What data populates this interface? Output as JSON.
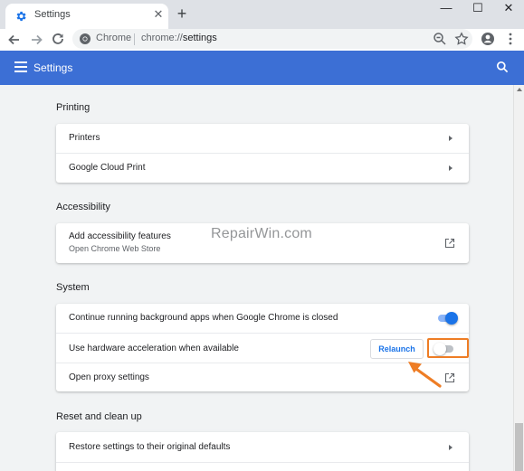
{
  "tab": {
    "title": "Settings",
    "icon": "gear-icon",
    "close_glyph": "✕"
  },
  "new_tab_glyph": "+",
  "window_controls": {
    "minimize": "—",
    "maximize": "☐",
    "close": "✕"
  },
  "omnibox": {
    "site_label": "Chrome",
    "url_scheme": "chrome://",
    "url_path": "settings"
  },
  "header": {
    "title": "Settings"
  },
  "colors": {
    "accent": "#3c6fd5",
    "toggle_on": "#1a73e8",
    "annotation": "#ee7d25"
  },
  "sections": {
    "printing": {
      "title": "Printing",
      "rows": [
        "Printers",
        "Google Cloud Print"
      ]
    },
    "accessibility": {
      "title": "Accessibility",
      "row_label": "Add accessibility features",
      "row_sub": "Open Chrome Web Store"
    },
    "system": {
      "title": "System",
      "background_apps": {
        "label": "Continue running background apps when Google Chrome is closed",
        "enabled": true
      },
      "hardware_acceleration": {
        "label": "Use hardware acceleration when available",
        "enabled": false,
        "button": "Relaunch"
      },
      "proxy": {
        "label": "Open proxy settings"
      }
    },
    "reset": {
      "title": "Reset and clean up",
      "rows": [
        "Restore settings to their original defaults"
      ]
    }
  },
  "watermark": "RepairWin.com"
}
